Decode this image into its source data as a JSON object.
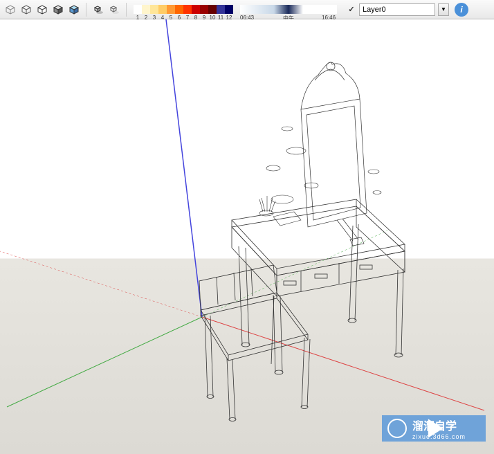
{
  "toolbar": {
    "color_scale": {
      "numbers": [
        "1",
        "2",
        "3",
        "4",
        "5",
        "6",
        "7",
        "8",
        "9",
        "10",
        "11",
        "12"
      ],
      "colors": [
        "#ffffff",
        "#fff5cc",
        "#ffe699",
        "#ffcc66",
        "#ff9933",
        "#ff6600",
        "#ff3300",
        "#cc0000",
        "#990000",
        "#660000",
        "#333399",
        "#000066"
      ]
    },
    "time_scale": {
      "start": "06:43",
      "mid": "中午",
      "end": "16:46"
    },
    "layer": {
      "selected": "Layer0"
    }
  },
  "watermark": {
    "title": "溜溜自学",
    "url": "zixue.3d66.com"
  }
}
